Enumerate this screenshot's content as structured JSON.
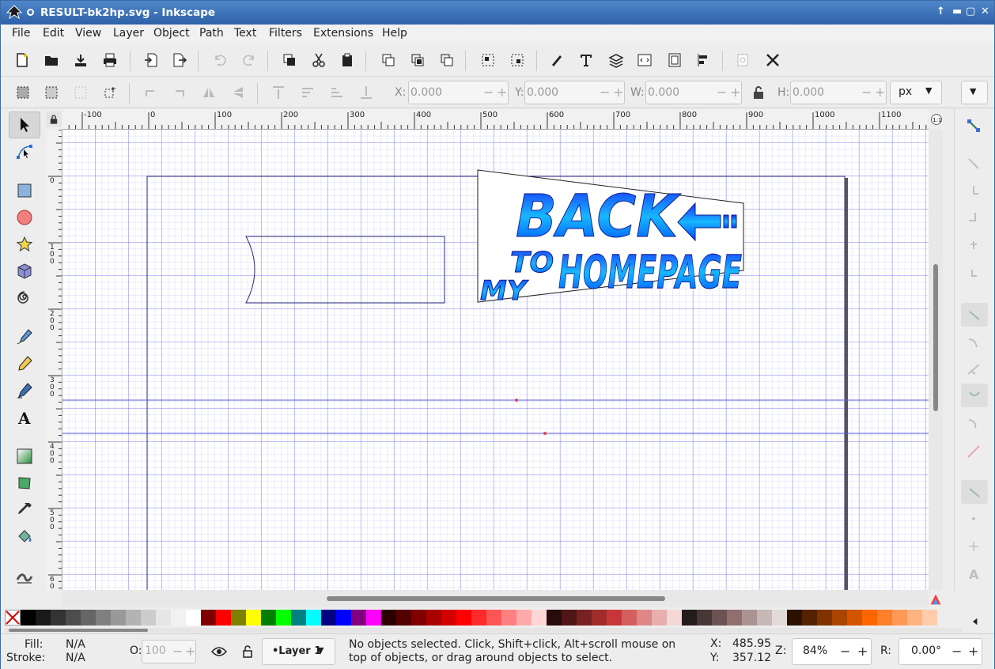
{
  "window": {
    "title": "RESULT-bk2hp.svg - Inkscape"
  },
  "menu": [
    "File",
    "Edit",
    "View",
    "Layer",
    "Object",
    "Path",
    "Text",
    "Filters",
    "Extensions",
    "Help"
  ],
  "controls": {
    "x_label": "X:",
    "x_value": "0.000",
    "y_label": "Y:",
    "y_value": "0.000",
    "w_label": "W:",
    "w_value": "0.000",
    "h_label": "H:",
    "h_value": "0.000",
    "unit": "px"
  },
  "ruler": {
    "h_ticks": [
      "-100",
      "0",
      "100",
      "200",
      "300",
      "400",
      "500",
      "600",
      "700",
      "800",
      "900",
      "1000",
      "1100"
    ],
    "v_ticks": [
      "0",
      "1\n0\n0",
      "2\n0\n0",
      "3\n0\n0",
      "4\n0\n0",
      "5\n0\n0",
      "6\n0\n0"
    ]
  },
  "artwork": {
    "line1": "BACK",
    "line2": "TO",
    "line3": "MY",
    "line4": "HOMEPAGE"
  },
  "palette": [
    "#000000",
    "#1a1a1a",
    "#333333",
    "#4d4d4d",
    "#666666",
    "#808080",
    "#999999",
    "#b3b3b3",
    "#cccccc",
    "#e6e6e6",
    "#f2f2f2",
    "#ffffff",
    "#800000",
    "#ff0000",
    "#808000",
    "#ffff00",
    "#008000",
    "#00ff00",
    "#008080",
    "#00ffff",
    "#000080",
    "#0000ff",
    "#800080",
    "#ff00ff",
    "#2b0000",
    "#550000",
    "#800000",
    "#aa0000",
    "#d40000",
    "#ff0000",
    "#ff2a2a",
    "#ff5555",
    "#ff8080",
    "#ffaaaa",
    "#ffd5d5",
    "#280b0b",
    "#501616",
    "#782121",
    "#a02c2c",
    "#c83737",
    "#d35f5f",
    "#de8787",
    "#e9afaf",
    "#f4d7d7",
    "#241c1c",
    "#483737",
    "#6c5353",
    "#916f6f",
    "#ac9393",
    "#c8b7b7",
    "#e3dbdb",
    "#2b1100",
    "#552200",
    "#803300",
    "#aa4400",
    "#d45500",
    "#ff6600",
    "#ff7f2a",
    "#ff9955",
    "#ffb380",
    "#ffccaa"
  ],
  "status": {
    "fill_label": "Fill:",
    "fill_value": "N/A",
    "stroke_label": "Stroke:",
    "stroke_value": "N/A",
    "opacity_label": "O:",
    "opacity_value": "100",
    "layer": "•Layer 1",
    "message": "No objects selected. Click, Shift+click, Alt+scroll mouse on top of objects, or drag around objects to select.",
    "x_label": "X:",
    "x_value": "485.95",
    "y_label": "Y:",
    "y_value": "357.12",
    "zoom_label": "Z:",
    "zoom_value": "84%",
    "rot_label": "R:",
    "rot_value": "0.00°"
  }
}
